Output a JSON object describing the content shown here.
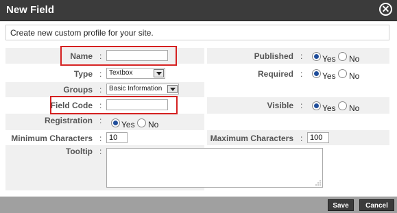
{
  "dialog": {
    "title": "New Field",
    "close_label": "✕"
  },
  "intro": "Create new custom profile for your site.",
  "fields": {
    "name": {
      "label": "Name",
      "value": ""
    },
    "type": {
      "label": "Type",
      "selected": "Textbox"
    },
    "groups": {
      "label": "Groups",
      "selected": "Basic Information"
    },
    "field_code": {
      "label": "Field Code",
      "value": ""
    },
    "registration": {
      "label": "Registration",
      "selected": "Yes"
    },
    "min_chars": {
      "label": "Minimum Characters",
      "value": "10"
    },
    "tooltip": {
      "label": "Tooltip",
      "value": ""
    },
    "published": {
      "label": "Published",
      "selected": "Yes"
    },
    "required": {
      "label": "Required",
      "selected": "Yes"
    },
    "visible": {
      "label": "Visible",
      "selected": "Yes"
    },
    "max_chars": {
      "label": "Maximum Characters",
      "value": "100"
    }
  },
  "radio_options": {
    "yes": "Yes",
    "no": "No"
  },
  "colon": ":",
  "buttons": {
    "save": "Save",
    "cancel": "Cancel"
  },
  "colors": {
    "titlebar": "#3b3b3b",
    "highlight": "#d42020",
    "footer": "#a0a0a0"
  }
}
